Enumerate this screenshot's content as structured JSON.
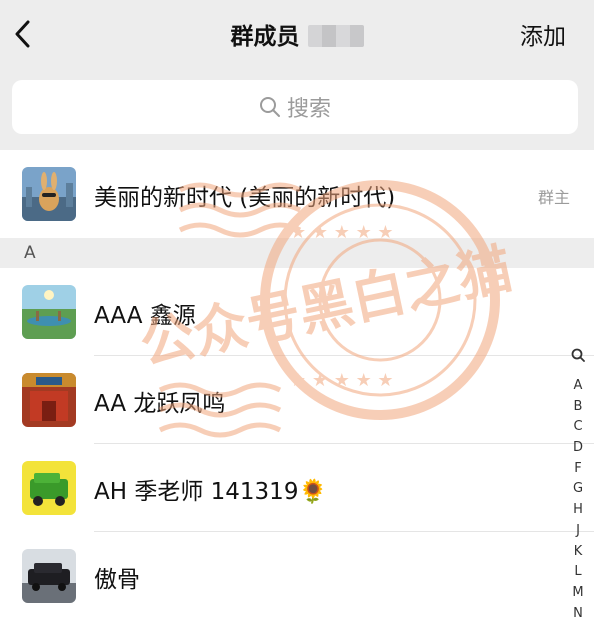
{
  "nav": {
    "title": "群成员",
    "add_label": "添加"
  },
  "search": {
    "placeholder": "搜索"
  },
  "owner": {
    "name": "美丽的新时代 (美丽的新时代)",
    "tag": "群主"
  },
  "section_a": {
    "letter": "A"
  },
  "members": [
    {
      "name": "AAA 鑫源"
    },
    {
      "name": "AA 龙跃凤鸣"
    },
    {
      "name": "AH 季老师 141319🌻"
    },
    {
      "name": "傲骨"
    }
  ],
  "index_bar": {
    "letters": [
      "A",
      "B",
      "C",
      "D",
      "F",
      "G",
      "H",
      "J",
      "K",
      "L",
      "M",
      "N"
    ]
  },
  "watermark": {
    "text": "公众号黑白之猫"
  },
  "colors": {
    "background": "#ededed",
    "row": "#ffffff",
    "watermark": "#f2a77e"
  }
}
